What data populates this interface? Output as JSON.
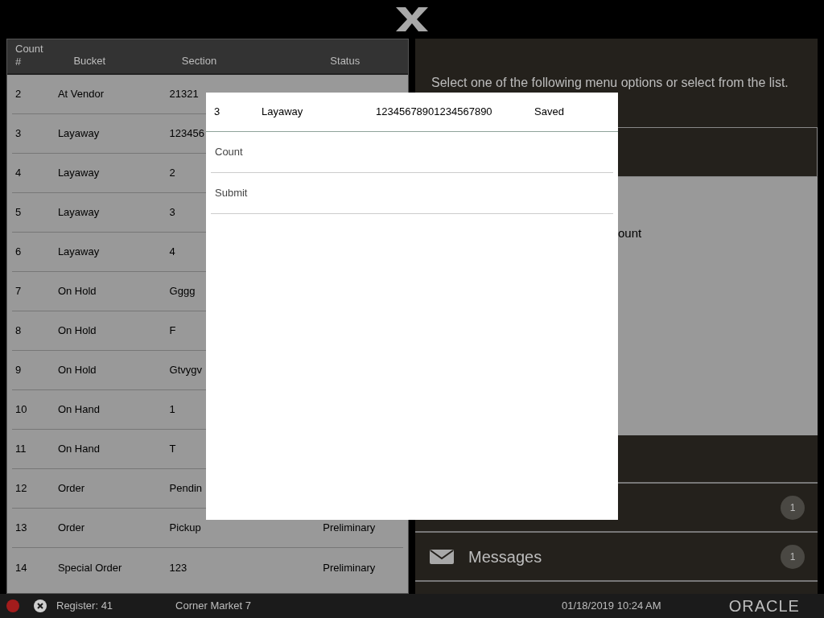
{
  "table": {
    "columns": [
      "Count #",
      "Bucket",
      "Section",
      "Status"
    ],
    "rows": [
      {
        "count": "2",
        "bucket": "At Vendor",
        "section": "21321"
      },
      {
        "count": "3",
        "bucket": "Layaway",
        "section": "123456"
      },
      {
        "count": "4",
        "bucket": "Layaway",
        "section": "2"
      },
      {
        "count": "5",
        "bucket": "Layaway",
        "section": "3"
      },
      {
        "count": "6",
        "bucket": "Layaway",
        "section": "4"
      },
      {
        "count": "7",
        "bucket": "On Hold",
        "section": "Gggg"
      },
      {
        "count": "8",
        "bucket": "On Hold",
        "section": "F"
      },
      {
        "count": "9",
        "bucket": "On Hold",
        "section": "Gtvygv"
      },
      {
        "count": "10",
        "bucket": "On Hand",
        "section": "1"
      },
      {
        "count": "11",
        "bucket": "On Hand",
        "section": "T"
      },
      {
        "count": "12",
        "bucket": "Order",
        "section": "Pendin"
      },
      {
        "count": "13",
        "bucket": "Order",
        "section": "Pickup",
        "status": "Preliminary"
      },
      {
        "count": "14",
        "bucket": "Special Order",
        "section": "123",
        "status": "Preliminary"
      }
    ]
  },
  "panel": {
    "instruction": "Select one of the following menu options or select from the list.",
    "partial_text": "ount",
    "menu": [
      {
        "kind": "badge",
        "badge": "1"
      },
      {
        "kind": "messages",
        "label": "Messages",
        "badge": "1"
      }
    ]
  },
  "dialog": {
    "header": [
      "3",
      "Layaway",
      "12345678901234567890",
      "Saved"
    ],
    "options": [
      "Count",
      "Submit"
    ]
  },
  "status_bar": {
    "register": "Register: 41",
    "store": "Corner Market 7",
    "datetime": "01/18/2019 10:24 AM",
    "brand": "ORACLE"
  }
}
